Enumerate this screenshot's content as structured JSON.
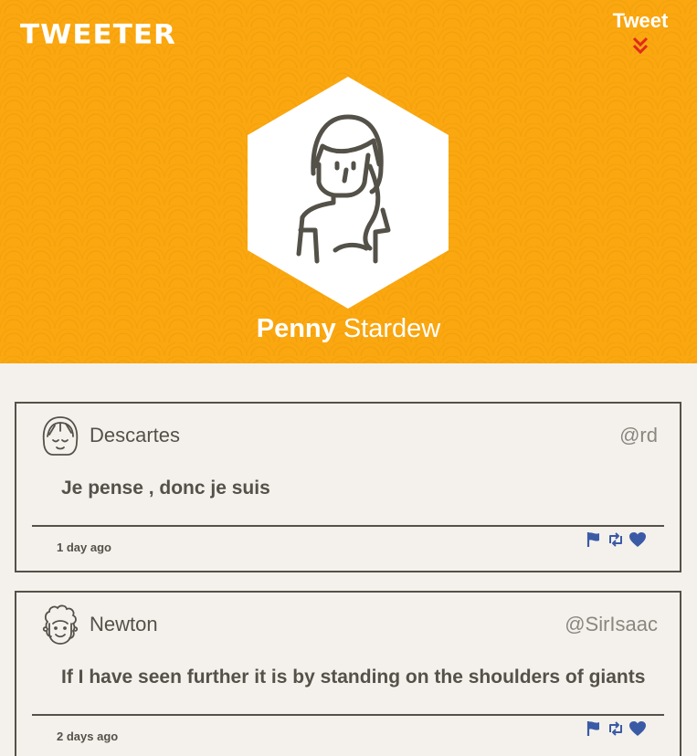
{
  "app": {
    "logo_text": "TWEETER"
  },
  "nav": {
    "tweet_label": "Tweet"
  },
  "profile": {
    "first_name": "Penny",
    "last_name": "Stardew"
  },
  "colors": {
    "header_bg": "#fba70f",
    "text": "#545149",
    "action_icon": "#3b5aa6",
    "chevron": "#e02a1c",
    "page_bg": "#f4f1ec"
  },
  "tweets": [
    {
      "author": "Descartes",
      "handle": "@rd",
      "text": "Je pense , donc je suis",
      "time": "1 day ago",
      "avatar_icon": "girl-avatar-icon"
    },
    {
      "author": "Newton",
      "handle": "@SirIsaac",
      "text": "If I have seen further it is by standing on the shoulders of giants",
      "time": "2 days ago",
      "avatar_icon": "curly-hair-avatar-icon"
    }
  ],
  "actions": [
    "flag-icon",
    "retweet-icon",
    "heart-icon"
  ]
}
